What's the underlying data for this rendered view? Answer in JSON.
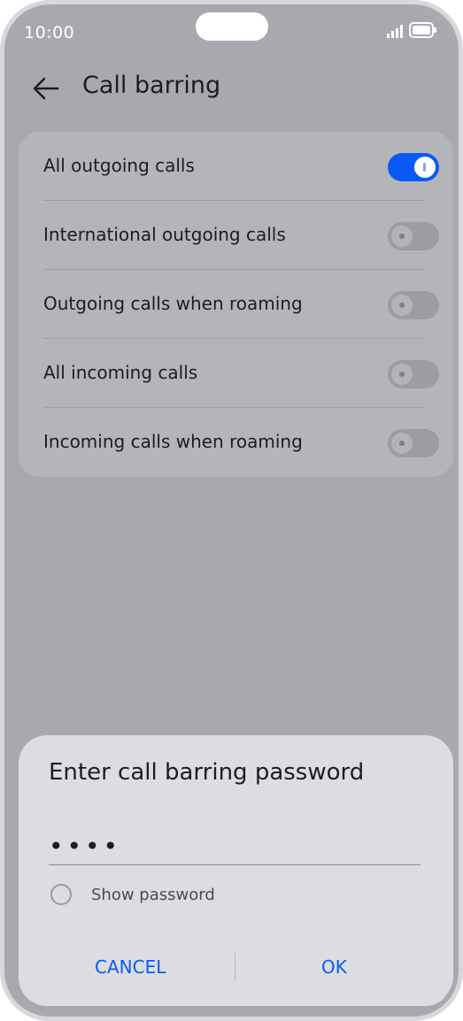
{
  "status_bar": {
    "time": "10:00",
    "icons": [
      "signal-icon",
      "battery-icon"
    ]
  },
  "header": {
    "back_icon": "arrow-left-icon",
    "title": "Call barring"
  },
  "settings": {
    "items": [
      {
        "label": "All outgoing calls",
        "enabled": true
      },
      {
        "label": "International outgoing calls",
        "enabled": false
      },
      {
        "label": "Outgoing calls when roaming",
        "enabled": false
      },
      {
        "label": "All incoming calls",
        "enabled": false
      },
      {
        "label": "Incoming calls when roaming",
        "enabled": false
      }
    ]
  },
  "dialog": {
    "title": "Enter call barring password",
    "password_value": "••••",
    "show_password_label": "Show password",
    "show_password_checked": false,
    "cancel_label": "CANCEL",
    "ok_label": "OK"
  },
  "colors": {
    "accent": "#0a59f7",
    "toggle_off": "#9c9da1",
    "dialog_bg": "#dcdde1"
  }
}
